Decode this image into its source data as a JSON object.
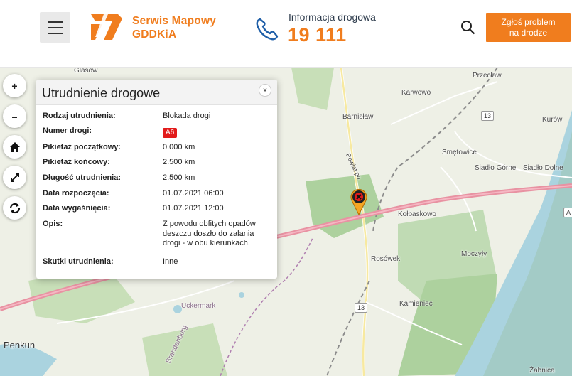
{
  "header": {
    "brand_line1": "Serwis Mapowy",
    "brand_line2": "GDDKiA",
    "info_label": "Informacja drogowa",
    "info_number": "19 111",
    "report_line1": "Zgłoś problem",
    "report_line2": "na drodze",
    "icons": {
      "menu": "hamburger-icon",
      "phone": "phone-icon",
      "search": "search-icon"
    }
  },
  "controls": [
    {
      "name": "zoom-in-button",
      "label": "+"
    },
    {
      "name": "zoom-out-button",
      "label": "–"
    },
    {
      "name": "home-button",
      "icon": "home-icon"
    },
    {
      "name": "fullscreen-button",
      "icon": "expand-icon"
    },
    {
      "name": "refresh-button",
      "icon": "refresh-icon"
    }
  ],
  "popup": {
    "title": "Utrudnienie drogowe",
    "close_label": "x",
    "rows": [
      {
        "label": "Rodzaj utrudnienia:",
        "value": "Blokada drogi"
      },
      {
        "label": "Numer drogi:",
        "value": "A6"
      },
      {
        "label": "Pikietaż początkowy:",
        "value": "0.000 km"
      },
      {
        "label": "Pikietaż końcowy:",
        "value": "2.500 km"
      },
      {
        "label": "Długość utrudnienia:",
        "value": "2.500 km"
      },
      {
        "label": "Data rozpoczęcia:",
        "value": "01.07.2021 06:00"
      },
      {
        "label": "Data wygaśnięcia:",
        "value": "01.07.2021 12:00"
      },
      {
        "label": "Opis:",
        "value": "Z powodu obfitych opadów deszczu doszło do zalania drogi - w obu kierunkach."
      },
      {
        "label": "Skutki utrudnienia:",
        "value": "Inne"
      }
    ]
  },
  "map": {
    "places": {
      "glasow": "Glasow",
      "przeclaw": "Przecław",
      "karwowo": "Karwowo",
      "barnislaw": "Barnisław",
      "kurow": "Kurów",
      "smetowice": "Smętowice",
      "siadlo_gorne": "Siadło Górne",
      "siadlo_dolne": "Siadło Dolne",
      "kolbaskowo": "Kołbaskowo",
      "moczyly": "Moczyły",
      "rosowek": "Rosówek",
      "kamieniec": "Kamieniec",
      "penkun": "Penkun",
      "uckermark": "Uckermark",
      "brandenburg": "Brandenburg",
      "zabnica": "Żabnica",
      "powiat": "Powiat po"
    },
    "shields": {
      "r13a": "13",
      "r13b": "13",
      "a": "A"
    },
    "marker_icon": "incident-marker-icon",
    "colors": {
      "motorway": "#e892a2",
      "water": "#aad3df",
      "forest": "#add19e",
      "accent": "#f07d1e"
    }
  }
}
